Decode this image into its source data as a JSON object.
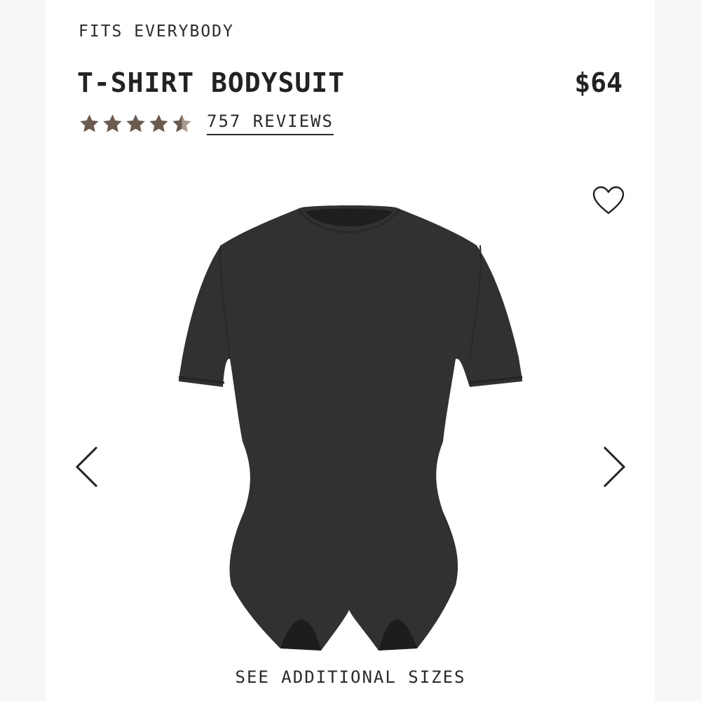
{
  "product": {
    "collection": "FITS EVERYBODY",
    "name": "T-SHIRT BODYSUIT",
    "price": "$64",
    "rating": 4.5,
    "rating_max": 5,
    "reviews_label": "757 REVIEWS"
  },
  "gallery": {
    "prev_icon": "chevron-left-icon",
    "next_icon": "chevron-right-icon",
    "wishlist_icon": "heart-outline-icon"
  },
  "actions": {
    "additional_sizes_label": "SEE ADDITIONAL SIZES"
  },
  "colors": {
    "star": "#6b5a4e",
    "garment": "#333030",
    "text": "#2a2a2a"
  }
}
